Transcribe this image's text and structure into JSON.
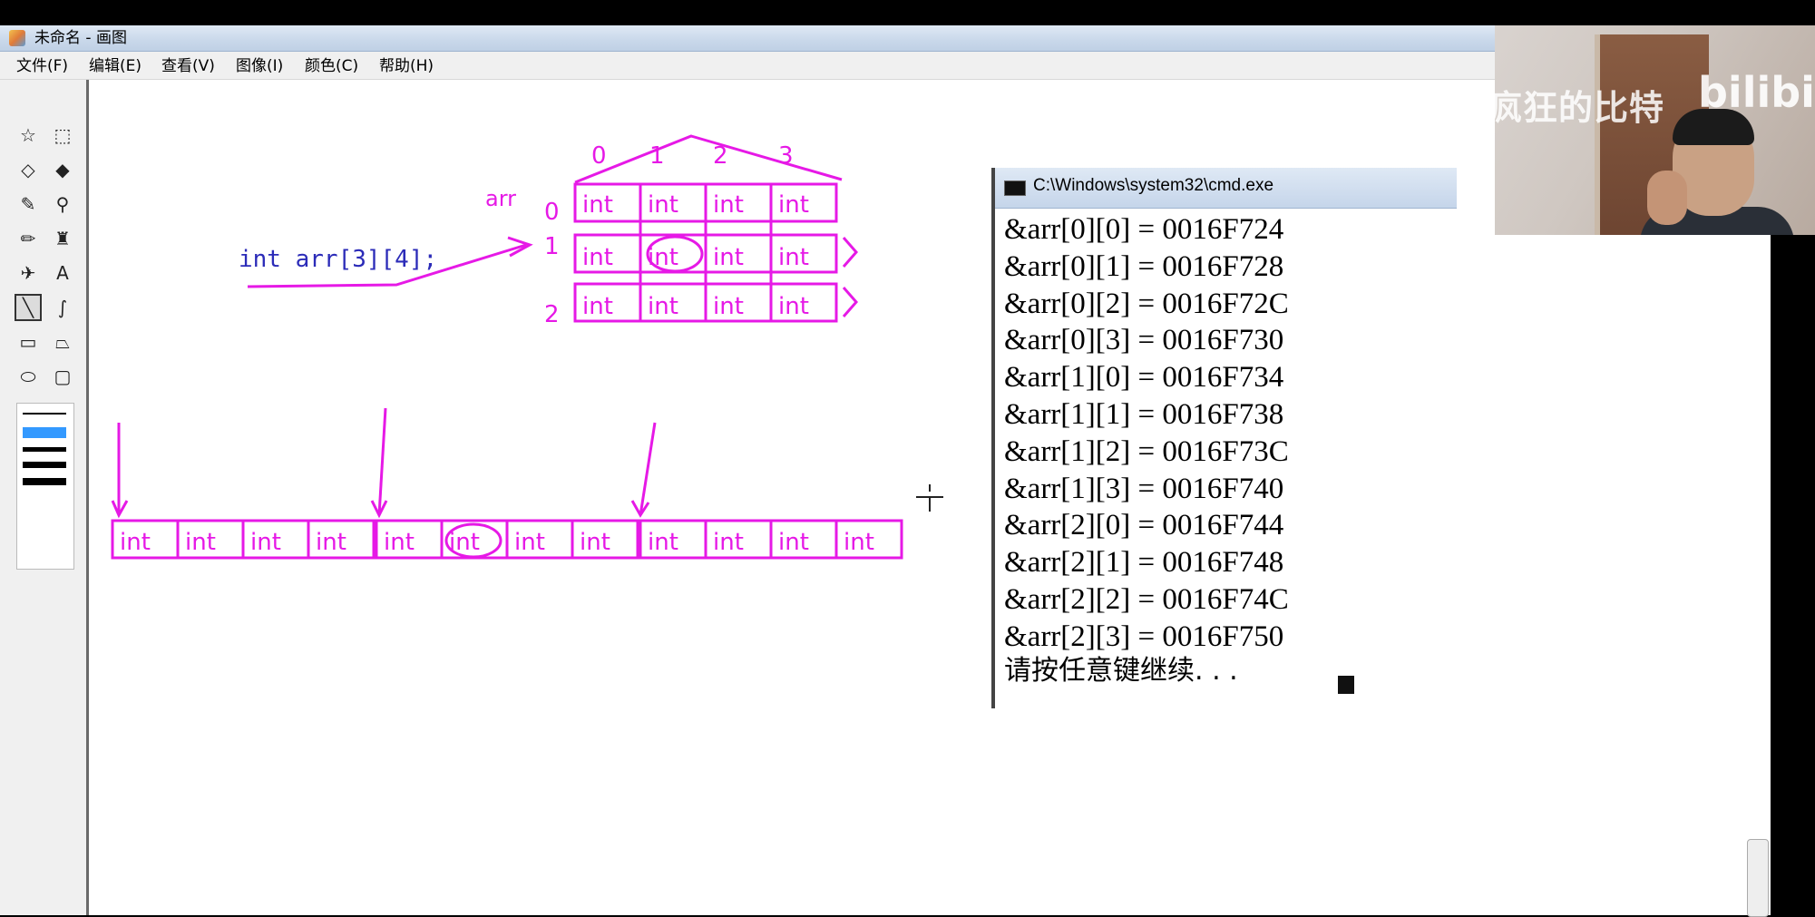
{
  "window": {
    "title": "未命名 - 画图"
  },
  "menu": [
    "文件(F)",
    "编辑(E)",
    "查看(V)",
    "图像(I)",
    "颜色(C)",
    "帮助(H)"
  ],
  "tools": [
    {
      "name": "free-select-icon",
      "glyph": "☆"
    },
    {
      "name": "rect-select-icon",
      "glyph": "⬚"
    },
    {
      "name": "eraser-icon",
      "glyph": "◇"
    },
    {
      "name": "fill-icon",
      "glyph": "◆"
    },
    {
      "name": "color-picker-icon",
      "glyph": "✎"
    },
    {
      "name": "magnifier-icon",
      "glyph": "⚲"
    },
    {
      "name": "pencil-icon",
      "glyph": "✏"
    },
    {
      "name": "brush-icon",
      "glyph": "♜"
    },
    {
      "name": "airbrush-icon",
      "glyph": "✈"
    },
    {
      "name": "text-icon",
      "glyph": "A"
    },
    {
      "name": "line-icon",
      "glyph": "╲"
    },
    {
      "name": "curve-icon",
      "glyph": "∫"
    },
    {
      "name": "rectangle-icon",
      "glyph": "▭"
    },
    {
      "name": "polygon-icon",
      "glyph": "⏢"
    },
    {
      "name": "ellipse-icon",
      "glyph": "⬭"
    },
    {
      "name": "rounded-rect-icon",
      "glyph": "▢"
    }
  ],
  "drawing": {
    "declaration": "int arr[3][4];",
    "array_label": "arr",
    "col_indices": [
      "0",
      "1",
      "2",
      "3"
    ],
    "row_indices": [
      "0",
      "1",
      "2"
    ],
    "cell_label": "int"
  },
  "cmd": {
    "title": "C:\\Windows\\system32\\cmd.exe",
    "lines": [
      "&arr[0][0] = 0016F724",
      "&arr[0][1] = 0016F728",
      "&arr[0][2] = 0016F72C",
      "&arr[0][3] = 0016F730",
      "&arr[1][0] = 0016F734",
      "&arr[1][1] = 0016F738",
      "&arr[1][2] = 0016F73C",
      "&arr[1][3] = 0016F740",
      "&arr[2][0] = 0016F744",
      "&arr[2][1] = 0016F748",
      "&arr[2][2] = 0016F74C",
      "&arr[2][3] = 0016F750"
    ],
    "prompt": "请按任意键继续. . ."
  },
  "overlay": {
    "watermark": "疯狂的比特",
    "logo_text": "bilibili"
  },
  "colors": {
    "ink": "#e619e6",
    "declaration": "#2b2bb8"
  }
}
